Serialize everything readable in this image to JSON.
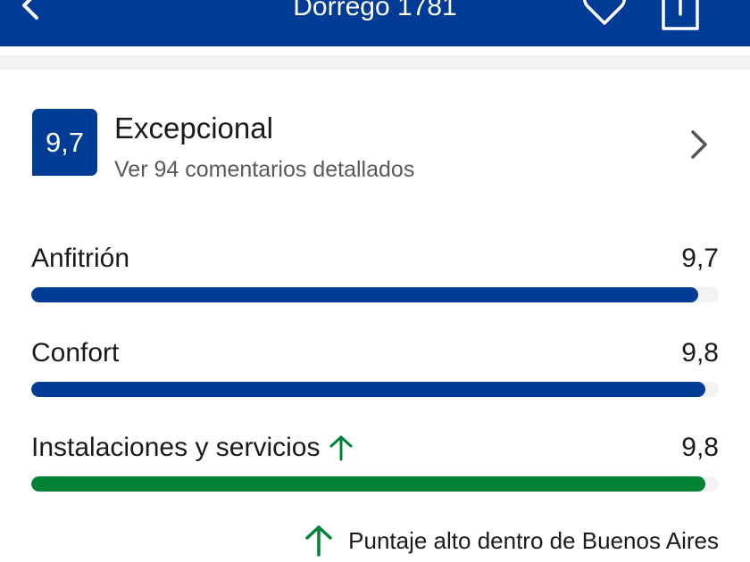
{
  "header": {
    "title": "Dorrego 1781",
    "icons": [
      "back-arrow-icon",
      "heart-icon",
      "share-icon"
    ]
  },
  "summary": {
    "score": "9,7",
    "label": "Excepcional",
    "comments_link": "Ver 94 comentarios detallados"
  },
  "categories": [
    {
      "name": "Anfitrión",
      "value_text": "9,7",
      "score": 9.7,
      "max": 10,
      "color": "#003b95",
      "high": false
    },
    {
      "name": "Confort",
      "value_text": "9,8",
      "score": 9.8,
      "max": 10,
      "color": "#003b95",
      "high": false
    },
    {
      "name": "Instalaciones y servicios",
      "value_text": "9,8",
      "score": 9.8,
      "max": 10,
      "color": "#008234",
      "high": true
    }
  ],
  "note": {
    "text": "Puntaje alto dentro de Buenos Aires"
  },
  "colors": {
    "brand": "#003b95",
    "highlight": "#008234",
    "track": "#f2f2f2"
  }
}
